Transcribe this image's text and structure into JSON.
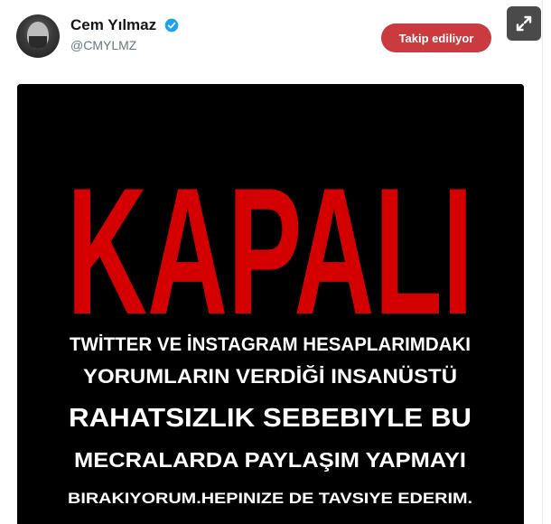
{
  "user": {
    "display_name": "Cem Yılmaz",
    "handle": "@CMYLMZ",
    "verified": true
  },
  "follow_button": {
    "label": "Takip ediliyor",
    "color": "#ca3a3f"
  },
  "icons": {
    "verified": "verified-badge-icon",
    "expand": "expand-arrows-icon",
    "menu": "chevron-down-icon"
  },
  "image": {
    "headline": "KAPALI",
    "headline_color": "#d40000",
    "lines": [
      "TWİTTER VE İNSTAGRAM HESAPLARIMDAKI",
      "YORUMLARIN VERDİĞİ INSANÜSTÜ",
      "RAHATSIZLIK SEBEBIYLE BU",
      "MECRALARDA PAYLAŞIM YAPMAYI",
      "BIRAKIYORUM.HEPINIZE DE TAVSIYE EDERIM."
    ]
  }
}
